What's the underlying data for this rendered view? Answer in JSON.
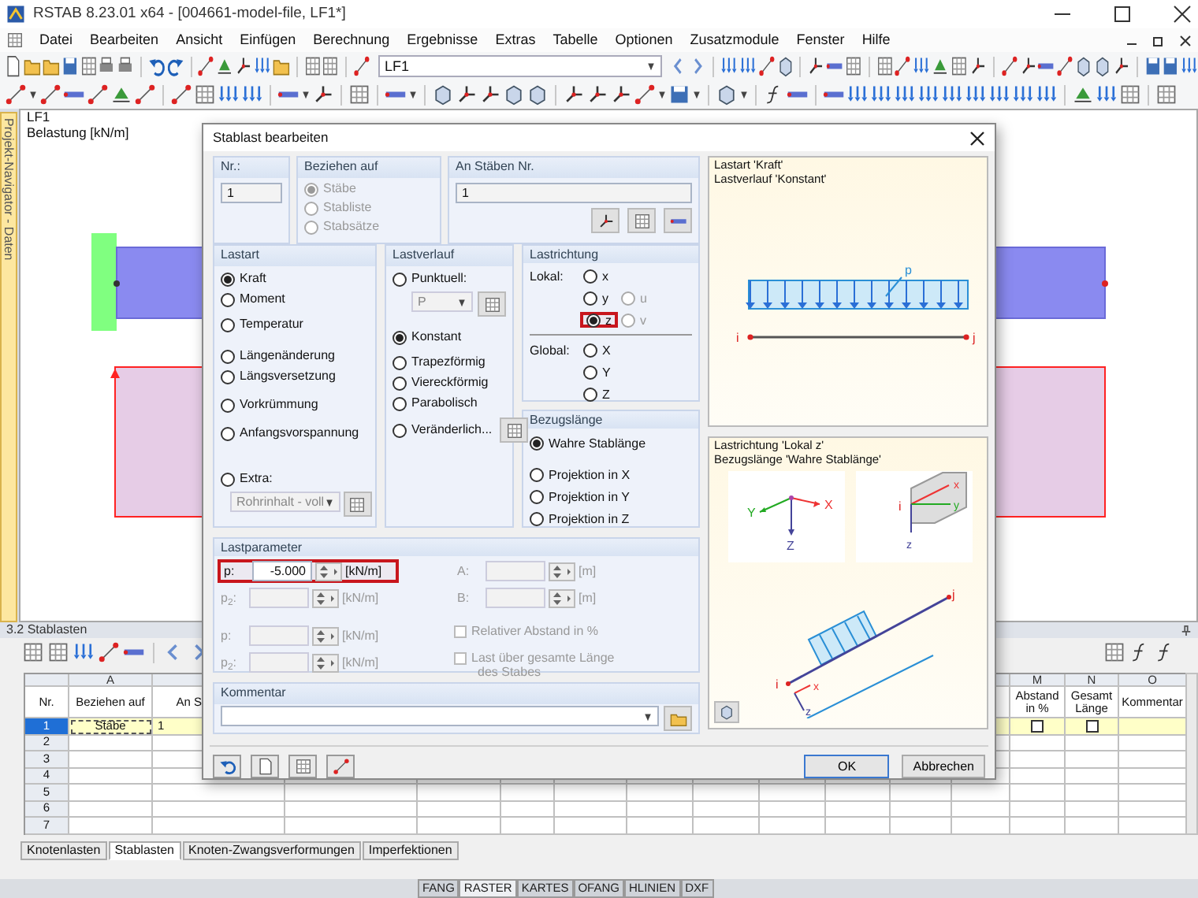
{
  "window": {
    "title": "RSTAB 8.23.01 x64 - [004661-model-file, LF1*]"
  },
  "menu": [
    "Datei",
    "Bearbeiten",
    "Ansicht",
    "Einfügen",
    "Berechnung",
    "Ergebnisse",
    "Extras",
    "Tabelle",
    "Optionen",
    "Zusatzmodule",
    "Fenster",
    "Hilfe"
  ],
  "toolbar": {
    "load_case": "LF1"
  },
  "navigator_tab": "Projekt-Navigator - Daten",
  "canvas": {
    "title": "LF1",
    "subtitle": "Belastung [kN/m]"
  },
  "panel": {
    "title": "3.2 Stablasten",
    "columns": [
      {
        "header": "Nr."
      },
      {
        "letter": "A",
        "header": "Beziehen auf"
      },
      {
        "header": "An S"
      },
      {
        "letter": "M",
        "header": "Abstand in %"
      },
      {
        "letter": "N",
        "header": "Gesamt Länge"
      },
      {
        "letter": "O",
        "header": "Kommentar"
      }
    ],
    "rows": [
      {
        "selected": true,
        "cells": [
          "1",
          "Stäbe",
          "1"
        ],
        "relative": false,
        "whole_length": false
      },
      {
        "selected": false,
        "cells": [
          "2"
        ]
      },
      {
        "selected": false,
        "cells": [
          "3"
        ]
      },
      {
        "selected": false,
        "cells": [
          "4"
        ]
      },
      {
        "selected": false,
        "cells": [
          "5"
        ]
      },
      {
        "selected": false,
        "cells": [
          "6"
        ]
      },
      {
        "selected": false,
        "cells": [
          "7"
        ]
      }
    ],
    "tabs": [
      {
        "label": "Knotenlasten",
        "selected": false
      },
      {
        "label": "Stablasten",
        "selected": true
      },
      {
        "label": "Knoten-Zwangsverformungen",
        "selected": false
      },
      {
        "label": "Imperfektionen",
        "selected": false
      }
    ]
  },
  "status_bar": [
    {
      "label": "FANG",
      "on": false
    },
    {
      "label": "RASTER",
      "on": true
    },
    {
      "label": "KARTES",
      "on": false
    },
    {
      "label": "OFANG",
      "on": false
    },
    {
      "label": "HLINIEN",
      "on": false
    },
    {
      "label": "DXF",
      "on": false
    }
  ],
  "dialog": {
    "title": "Stablast bearbeiten",
    "nr": {
      "label": "Nr.:",
      "value": "1"
    },
    "relate": {
      "label": "Beziehen auf",
      "disabled": true,
      "options": [
        {
          "label": "Stäbe",
          "selected": true
        },
        {
          "label": "Stabliste",
          "selected": false
        },
        {
          "label": "Stabsätze",
          "selected": false
        }
      ]
    },
    "members": {
      "label": "An Stäben Nr.",
      "value": "1"
    },
    "load_type": {
      "label": "Lastart",
      "extra_value": "Rohrinhalt - voll",
      "options": [
        {
          "label": "Kraft",
          "selected": true
        },
        {
          "label": "Moment",
          "selected": false
        },
        {
          "label": "Temperatur",
          "selected": false
        },
        {
          "label": "Längenänderung",
          "selected": false
        },
        {
          "label": "Längsversetzung",
          "selected": false
        },
        {
          "label": "Vorkrümmung",
          "selected": false
        },
        {
          "label": "Anfangsvorspannung",
          "selected": false
        },
        {
          "label": "Extra:",
          "selected": false
        }
      ]
    },
    "distribution": {
      "label": "Lastverlauf",
      "point_value": "P",
      "options": [
        {
          "label": "Punktuell:",
          "selected": false
        },
        {
          "label": "Konstant",
          "selected": true
        },
        {
          "label": "Trapezförmig",
          "selected": false
        },
        {
          "label": "Viereckförmig",
          "selected": false
        },
        {
          "label": "Parabolisch",
          "selected": false
        },
        {
          "label": "Veränderlich...",
          "selected": false
        }
      ]
    },
    "direction": {
      "label": "Lastrichtung",
      "local_label": "Lokal:",
      "global_label": "Global:",
      "local": [
        {
          "label": "x",
          "selected": false,
          "disabled": false,
          "framed": false
        },
        {
          "label": "y",
          "selected": false,
          "disabled": false,
          "framed": false
        },
        {
          "label": "z",
          "selected": true,
          "disabled": false,
          "framed": true
        },
        {
          "label": "u",
          "selected": false,
          "disabled": true,
          "framed": false
        },
        {
          "label": "v",
          "selected": false,
          "disabled": true,
          "framed": false
        }
      ],
      "global": [
        {
          "label": "X",
          "selected": false
        },
        {
          "label": "Y",
          "selected": false
        },
        {
          "label": "Z",
          "selected": false
        }
      ]
    },
    "reference": {
      "label": "Bezugslänge",
      "options": [
        {
          "label": "Wahre Stablänge",
          "selected": true
        },
        {
          "label": "Projektion in X",
          "selected": false
        },
        {
          "label": "Projektion in Y",
          "selected": false
        },
        {
          "label": "Projektion in Z",
          "selected": false
        }
      ]
    },
    "parameters": {
      "label": "Lastparameter",
      "fields": [
        {
          "label": "p:",
          "value": "-5.000",
          "unit": "[kN/m]",
          "disabled": false,
          "framed": true
        },
        {
          "label": "A:",
          "unit": "[m]",
          "disabled": true,
          "framed": false
        },
        {
          "label": "p$_{2}$:",
          "unit": "[kN/m]",
          "disabled": true,
          "framed": false
        },
        {
          "label": "B:",
          "unit": "[m]",
          "disabled": true,
          "framed": false
        },
        {
          "label": "p:",
          "unit": "[kN/m]",
          "disabled": true,
          "framed": false
        },
        {
          "label": "p$_{2}$:",
          "unit": "[kN/m]",
          "disabled": true,
          "framed": false
        }
      ],
      "checks": [
        {
          "label": "Relativer Abstand in %",
          "checked": false,
          "disabled": true
        },
        {
          "label": "Last über gesamte Länge",
          "note": "des Stabes",
          "checked": false,
          "disabled": true
        }
      ]
    },
    "comment": {
      "label": "Kommentar"
    },
    "load_preview": {
      "lines": [
        "Lastart 'Kraft'",
        "Lastverlauf 'Konstant'"
      ],
      "labels": [
        "p",
        "i",
        "j"
      ]
    },
    "axes_preview": {
      "lines": [
        "Lastrichtung 'Lokal z'",
        "Bezugslänge 'Wahre Stablänge'"
      ],
      "global_labels": [
        "Y",
        "X",
        "Z"
      ],
      "local_labels": [
        "i",
        "x",
        "y",
        "z"
      ],
      "member_labels": [
        "j",
        "i",
        "x",
        "z"
      ]
    },
    "buttons": [
      {
        "label": "OK",
        "default": true
      },
      {
        "label": "Abbrechen",
        "default": false
      }
    ]
  }
}
